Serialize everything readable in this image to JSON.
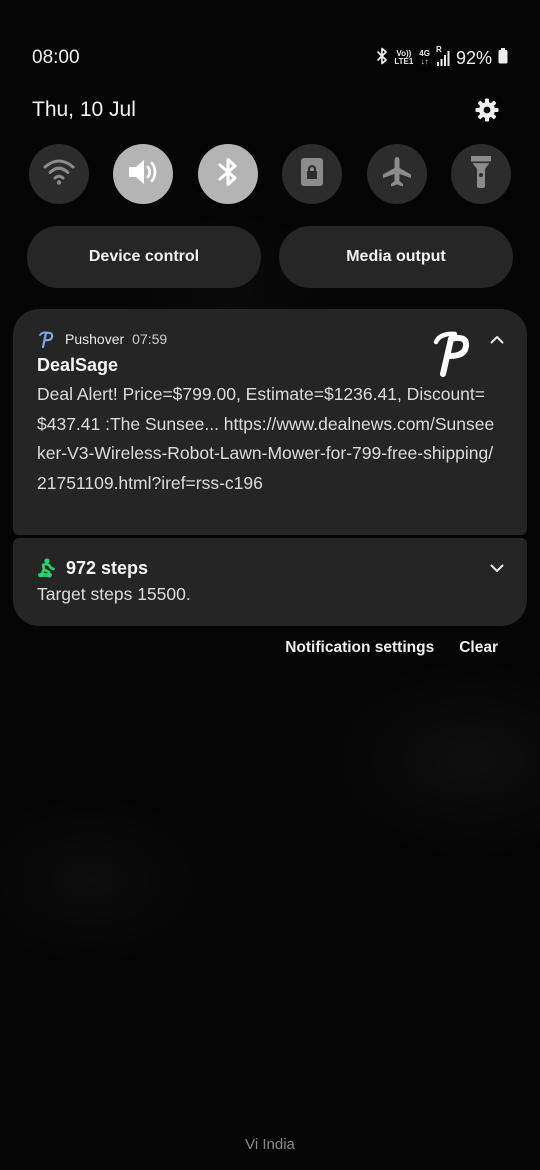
{
  "status_bar": {
    "time": "08:00",
    "volte_top": "Vo))",
    "volte_bottom": "LTE1",
    "net_top": "4G",
    "net_bottom": "↓↑",
    "roaming": "R",
    "battery": "92%",
    "icons": [
      "bluetooth-icon",
      "signal-icon",
      "battery-icon"
    ]
  },
  "header": {
    "date": "Thu, 10 Jul",
    "settings_icon": "gear-icon"
  },
  "quick_tiles": [
    {
      "icon": "wifi-icon",
      "active": false
    },
    {
      "icon": "sound-icon",
      "active": true
    },
    {
      "icon": "bluetooth-icon",
      "active": true
    },
    {
      "icon": "screen-lock-icon",
      "active": false
    },
    {
      "icon": "airplane-icon",
      "active": false
    },
    {
      "icon": "flashlight-icon",
      "active": false
    }
  ],
  "pills": {
    "device_control": "Device control",
    "media_output": "Media output"
  },
  "notifications": [
    {
      "app": "Pushover",
      "time": "07:59",
      "title": "DealSage",
      "body": "Deal Alert! Price=$799.00, Estimate=$1236.41, Discount=$437.41 :The Sunsee... https://www.dealnews.com/Sunseeker-V3-Wireless-Robot-Lawn-Mower-for-799-free-shipping/21751109.html?iref=rss-c196",
      "expanded": true
    },
    {
      "title": "972 steps",
      "body": "Target steps 15500.",
      "expanded": false
    }
  ],
  "actions": {
    "settings": "Notification settings",
    "clear": "Clear"
  },
  "carrier": "Vi India",
  "colors": {
    "background": "#050505",
    "tile_off": "#2c2c2c",
    "tile_on": "#b4b4b4",
    "card": "#252525",
    "steps_green": "#2bd46a"
  }
}
